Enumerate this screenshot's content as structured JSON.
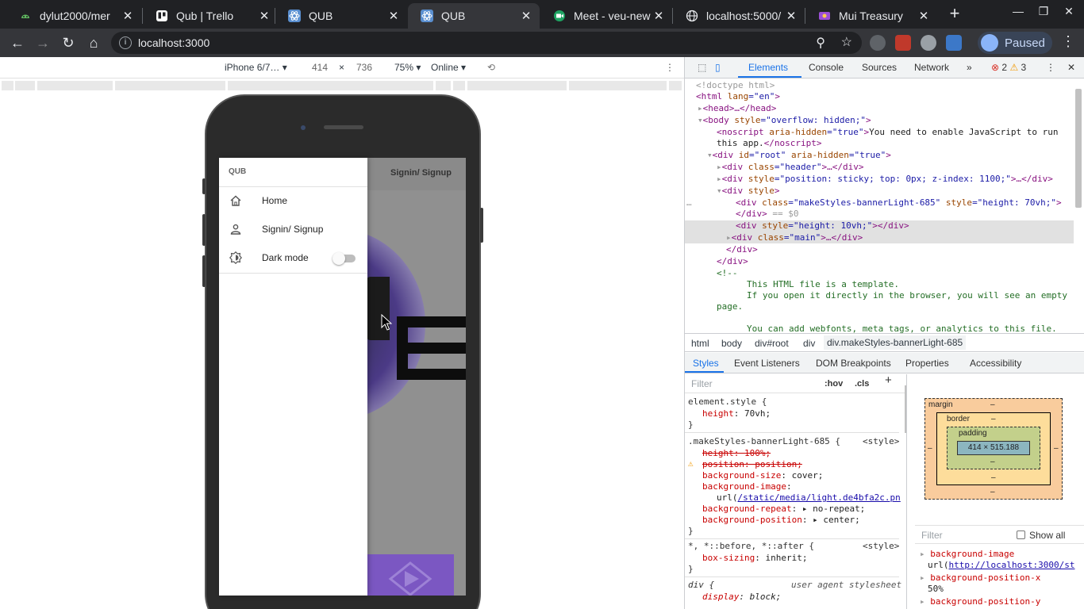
{
  "browser": {
    "tabs": [
      {
        "title": "dylut2000/mer",
        "icon": "github-icon"
      },
      {
        "title": "Qub | Trello",
        "icon": "trello-icon"
      },
      {
        "title": "QUB",
        "icon": "react-icon"
      },
      {
        "title": "QUB",
        "icon": "react-icon",
        "active": true
      },
      {
        "title": "Meet - veu-new",
        "icon": "meet-icon"
      },
      {
        "title": "localhost:5000/",
        "icon": "globe-icon"
      },
      {
        "title": "Mui Treasury",
        "icon": "mui-icon"
      }
    ],
    "url": "localhost:3000",
    "profile_label": "Paused"
  },
  "device_toolbar": {
    "device": "iPhone 6/7…",
    "width": "414",
    "times": "×",
    "height": "736",
    "zoom": "75%",
    "network": "Online"
  },
  "app": {
    "header_signin": "Signin/ Signup",
    "drawer": {
      "brand": "QUB",
      "items": [
        {
          "label": "Home",
          "icon": "home-icon"
        },
        {
          "label": "Signin/ Signup",
          "icon": "person-icon"
        },
        {
          "label": "Dark mode",
          "icon": "brightness-icon"
        }
      ],
      "dark_mode_on": false
    }
  },
  "devtools": {
    "tabs": [
      "Elements",
      "Console",
      "Sources",
      "Network",
      "»"
    ],
    "active_tab": "Elements",
    "errors": "2",
    "warnings": "3",
    "dom_lines": {
      "l0": "<!doctype html>",
      "l1a": "<html",
      "l1b": " lang",
      "l1c": "=\"en\"",
      "l1d": ">",
      "l2": "<head>…</head>",
      "l3a": "<body",
      "l3b": " style",
      "l3c": "=\"overflow: hidden;\"",
      "l3d": ">",
      "l4a": "<noscript",
      "l4b": " aria-hidden",
      "l4c": "=\"true\"",
      "l4d": ">",
      "l4e": "You need to enable JavaScript to run",
      "l5a": "this app.",
      "l5b": "</noscript>",
      "l6a": "<div",
      "l6b": " id",
      "l6c": "=\"root\"",
      "l6d": " aria-hidden",
      "l6e": "=\"true\"",
      "l6f": ">",
      "l7a": "<div",
      "l7b": " class",
      "l7c": "=\"header\"",
      "l7d": ">…</div>",
      "l8a": "<div",
      "l8b": " style",
      "l8c": "=\"position: sticky; top: 0px; z-index: 1100;\"",
      "l8d": ">…</div>",
      "l9a": "<div",
      "l9b": " style",
      "l9c": ">",
      "l10a": "<div",
      "l10b": " class",
      "l10c": "=\"makeStyles-bannerLight-685\"",
      "l10d": " style",
      "l10e": "=\"height: 70vh;\"",
      "l10f": ">",
      "l11a": "</div>",
      "l11b": " == $0",
      "l12a": "<div",
      "l12b": " style",
      "l12c": "=\"height: 10vh;\"",
      "l12d": "></div>",
      "l13a": "<div",
      "l13b": " class",
      "l13c": "=\"main\"",
      "l13d": ">…</div>",
      "l14": "</div>",
      "l15": "</div>",
      "l16": "<!--",
      "l17": "This HTML file is a template.",
      "l18": "If you open it directly in the browser, you will see an empty",
      "l19": "page.",
      "l20": "You can add webfonts, meta tags, or analytics to this file."
    },
    "breadcrumbs": [
      "html",
      "body",
      "div#root",
      "div",
      "div.makeStyles-bannerLight-685"
    ],
    "sub_tabs": [
      "Styles",
      "Event Listeners",
      "DOM Breakpoints",
      "Properties",
      "Accessibility"
    ],
    "filter_placeholder": "Filter",
    "hov": ":hov",
    "cls": ".cls",
    "styles": {
      "r1_sel": "element.style {",
      "r1_p1": "height",
      "r1_v1": ": 70vh;",
      "close": "}",
      "r2_sel": ".makeStyles-bannerLight-685 {",
      "r2_src": "<style>",
      "r2_p1": "height: 100%;",
      "r2_p2": "position: position;",
      "r2_p3": "background-size",
      "r2_v3": ": cover;",
      "r2_p4": "background-image",
      "r2_v4a": "url(",
      "r2_v4b": "/static/media/light.de4bfa2c.pn",
      "r2_p5": "background-repeat",
      "r2_v5": ": ▸ no-repeat;",
      "r2_p6": "background-position",
      "r2_v6": ": ▸ center;",
      "r3_sel": "*, *::before, *::after {",
      "r3_src": "<style>",
      "r3_p1": "box-sizing",
      "r3_v1": ": inherit;",
      "r4_sel": "div {",
      "r4_src": "user agent stylesheet",
      "r4_p1": "display",
      "r4_v1": ": block;"
    },
    "box_model": {
      "margin": "margin",
      "border": "border",
      "padding": "padding",
      "dash": "–",
      "content": "414 × 515.188"
    },
    "computed": {
      "filter": "Filter",
      "show_all": "Show all",
      "p1": "background-image",
      "v1a": "url(",
      "v1b": "http://localhost:3000/st",
      "p2": "background-position-x",
      "v2": "50%",
      "p3": "background-position-y"
    }
  },
  "colors": {
    "accent": "#1a73e8",
    "tab_strip": "#202124",
    "toolbar": "#35363a",
    "app_purple": "#7b57c2"
  }
}
